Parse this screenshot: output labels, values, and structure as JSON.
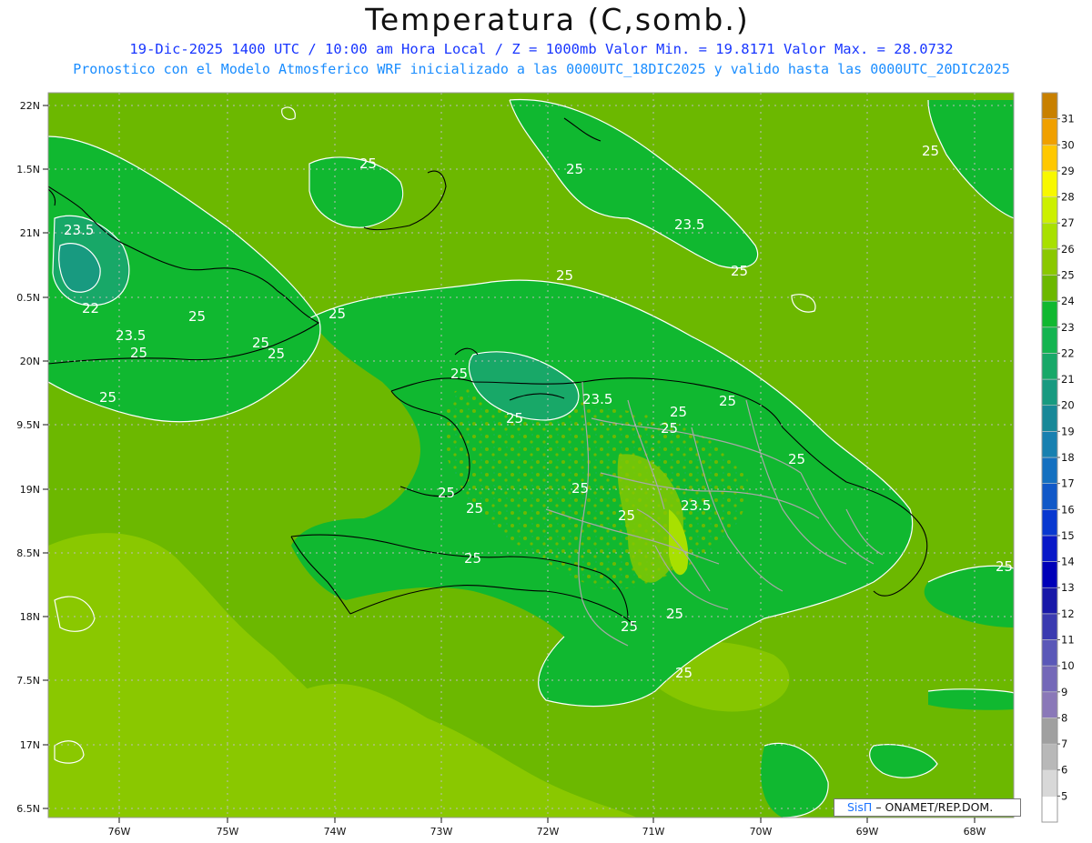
{
  "header": {
    "title": "Temperatura (C,somb.)",
    "line1": "19-Dic-2025 1400 UTC / 10:00 am Hora Local / Z = 1000mb  Valor Min. = 19.8171  Valor Max. = 28.0732",
    "line2": "Pronostico con el Modelo Atmosferico WRF inicializado a las 0000UTC_18DIC2025 y valido hasta las  0000UTC_20DIC2025"
  },
  "axes": {
    "lat_labels": [
      "22N",
      "1.5N",
      "21N",
      "0.5N",
      "20N",
      "9.5N",
      "19N",
      "8.5N",
      "18N",
      "7.5N",
      "17N",
      "6.5N"
    ],
    "lon_labels": [
      "76W",
      "75W",
      "74W",
      "73W",
      "72W",
      "71W",
      "70W",
      "69W",
      "68W"
    ]
  },
  "colorbar": {
    "levels": [
      "5",
      "6",
      "7",
      "8",
      "9",
      "10",
      "11",
      "12",
      "13",
      "14",
      "15",
      "16",
      "17",
      "18",
      "19",
      "20",
      "21",
      "22",
      "23",
      "24",
      "25",
      "26",
      "27",
      "28",
      "29",
      "30",
      "31"
    ],
    "colors": [
      "#ffffff",
      "#d8d8d8",
      "#b8b8b8",
      "#a0a0a0",
      "#8a78b8",
      "#7468b8",
      "#5a58b8",
      "#3a3ab0",
      "#1818a8",
      "#0000b8",
      "#0818c8",
      "#0838d0",
      "#1058c8",
      "#1470c0",
      "#1880b0",
      "#188898",
      "#189a80",
      "#18a868",
      "#14b450",
      "#10b830",
      "#6cb800",
      "#8ac800",
      "#a8e000",
      "#ccf000",
      "#f8f800",
      "#ffc800",
      "#f0a000",
      "#c88000"
    ]
  },
  "contour_labels": [
    {
      "text": "23.5"
    },
    {
      "text": "22"
    },
    {
      "text": "23.5"
    },
    {
      "text": "25"
    },
    {
      "text": "25"
    },
    {
      "text": "25"
    },
    {
      "text": "25"
    },
    {
      "text": "25"
    },
    {
      "text": "25"
    },
    {
      "text": "25"
    },
    {
      "text": "23.5"
    },
    {
      "text": "25"
    },
    {
      "text": "25"
    },
    {
      "text": "25"
    },
    {
      "text": "25"
    },
    {
      "text": "25"
    },
    {
      "text": "25"
    },
    {
      "text": "25"
    },
    {
      "text": "23.5"
    },
    {
      "text": "25"
    },
    {
      "text": "25"
    },
    {
      "text": "25"
    },
    {
      "text": "25"
    },
    {
      "text": "25"
    },
    {
      "text": "25"
    },
    {
      "text": "25"
    },
    {
      "text": "25"
    },
    {
      "text": "25"
    },
    {
      "text": "25"
    },
    {
      "text": "25"
    },
    {
      "text": "23.5"
    },
    {
      "text": "25"
    }
  ],
  "credit": {
    "brand": "SisΠ",
    "text": "– ONAMET/REP.DOM."
  }
}
